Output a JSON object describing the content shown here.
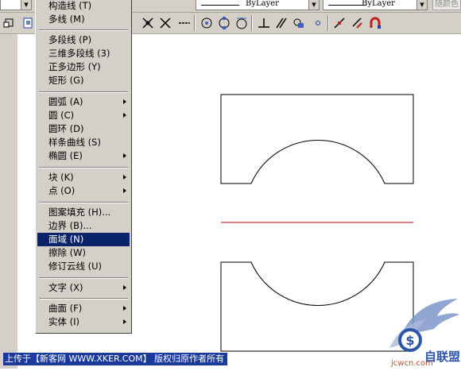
{
  "properties_bar": {
    "linetype_value": "ByLayer",
    "lineweight_value": "ByLayer",
    "plotstyle_value": "随颜色"
  },
  "toolbar": {
    "icons": [
      "layer-icon",
      "copy-icon",
      "perpendicular-icon",
      "tangent-icon",
      "line-icon",
      "center-icon",
      "quadrant-icon",
      "tangent-circle-icon",
      "perpendicular-snap-icon",
      "parallel-icon",
      "insert-icon",
      "node-icon",
      "nearest-icon",
      "magnet-icon"
    ]
  },
  "draw_menu": {
    "items": [
      {
        "label": "构造线 (T)",
        "submenu": false
      },
      {
        "label": "多线 (M)",
        "submenu": false
      },
      {
        "label": "多段线 (P)",
        "submenu": false
      },
      {
        "label": "三维多段线 (3)",
        "submenu": false
      },
      {
        "label": "正多边形 (Y)",
        "submenu": false
      },
      {
        "label": "矩形 (G)",
        "submenu": false
      },
      {
        "label": "圆弧 (A)",
        "submenu": true
      },
      {
        "label": "圆 (C)",
        "submenu": true
      },
      {
        "label": "圆环 (D)",
        "submenu": false
      },
      {
        "label": "样条曲线 (S)",
        "submenu": false
      },
      {
        "label": "椭圆 (E)",
        "submenu": true
      },
      {
        "label": "块 (K)",
        "submenu": true
      },
      {
        "label": "点 (O)",
        "submenu": true
      },
      {
        "label": "图案填充 (H)...",
        "submenu": false
      },
      {
        "label": "边界 (B)...",
        "submenu": false
      },
      {
        "label": "面域 (N)",
        "submenu": false,
        "highlighted": true
      },
      {
        "label": "擦除 (W)",
        "submenu": false
      },
      {
        "label": "修订云线 (U)",
        "submenu": false
      },
      {
        "label": "文字 (X)",
        "submenu": true
      },
      {
        "label": "曲面 (F)",
        "submenu": true
      },
      {
        "label": "实体 (I)",
        "submenu": true
      }
    ]
  },
  "footer": {
    "text": "上传于【新客网 WWW.XKER.COM】 版权归原作者所有"
  },
  "watermark": {
    "site": "jcwcn.com",
    "brand": "自联盟"
  },
  "colors": {
    "highlight": "#0a246a",
    "footer_bg": "#1c3a9c",
    "red_line": "#cc0000",
    "ui_face": "#d4d0c8"
  }
}
